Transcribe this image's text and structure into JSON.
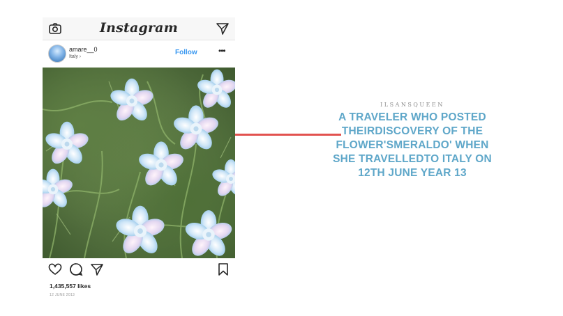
{
  "app": {
    "wordmark": "Instagram"
  },
  "post": {
    "username": "amare__0",
    "location": "Italy ›",
    "follow_label": "Follow",
    "more_label": "•••",
    "likes": "1,435,557 likes",
    "date": "12 JUNE 2013"
  },
  "overlay": {
    "author": "ILSANSQUEEN",
    "caption_lines": [
      "A TRAVELER WHO POSTED",
      "THEIRDISCOVERY OF THE",
      "FLOWER'SMERALDO' WHEN",
      "SHE TRAVELLEDTO ITALY ON",
      "12TH JUNE YEAR 13"
    ]
  },
  "colors": {
    "caption": "#5fa7c9",
    "connector": "#e2524f",
    "follow": "#3897f0"
  },
  "icons": {
    "top_left": "camera-icon",
    "top_right": "direct-send-icon",
    "actions": [
      "heart-icon",
      "comment-icon",
      "share-icon",
      "bookmark-icon"
    ]
  }
}
